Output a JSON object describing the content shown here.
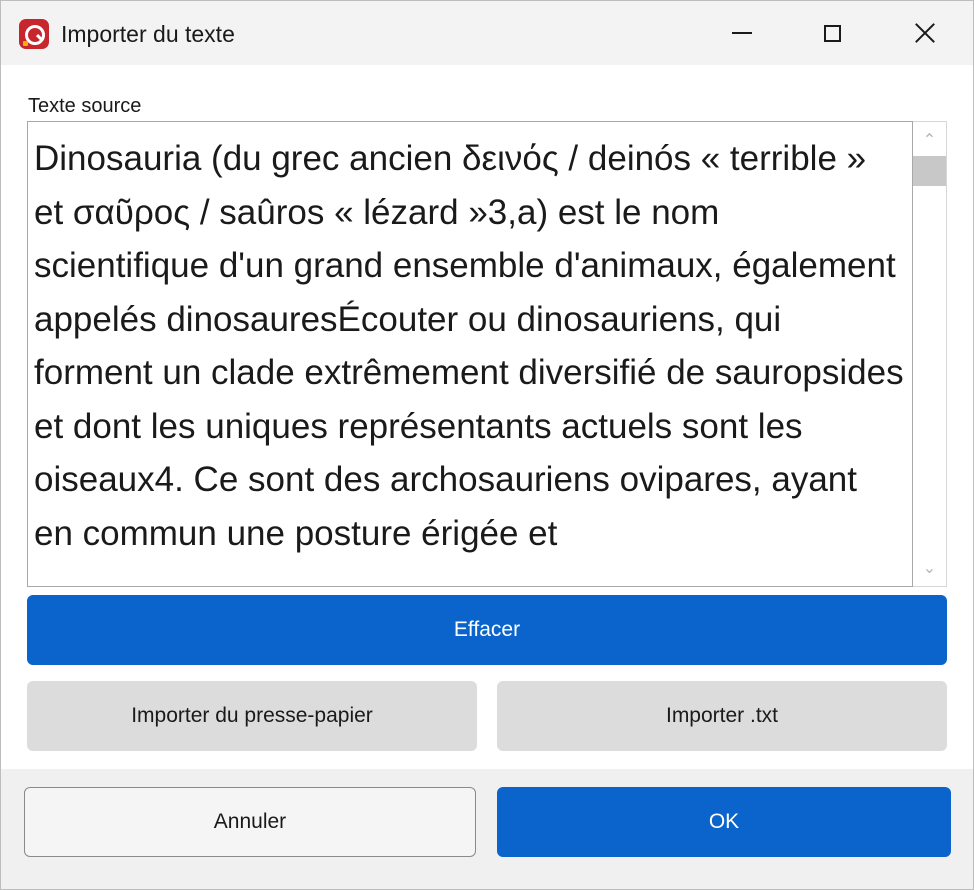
{
  "window": {
    "title": "Importer du texte",
    "icon": "app-logo-icon",
    "controls": [
      "minimize-icon",
      "maximize-icon",
      "close-icon"
    ]
  },
  "source": {
    "label": "Texte source",
    "text": "Dinosauria (du grec ancien δεινός / deinós « terrible » et σαῦρος / saûros « lézard »3,a) est le nom scientifique d'un grand ensemble d'animaux, également appelés dinosauresÉcouter ou dinosauriens, qui forment un clade extrêmement diversifié de sauropsides et dont les uniques représentants actuels sont les oiseaux4. Ce sont des archosauriens ovipares, ayant en commun une posture érigée et"
  },
  "buttons": {
    "clear": "Effacer",
    "import_clipboard": "Importer du presse-papier",
    "import_txt": "Importer .txt",
    "cancel": "Annuler",
    "ok": "OK"
  },
  "colors": {
    "accent": "#0a64cc",
    "secondary_button": "#dcdcdc",
    "footer": "#f0f0f0",
    "app_icon": "#c8262d"
  }
}
